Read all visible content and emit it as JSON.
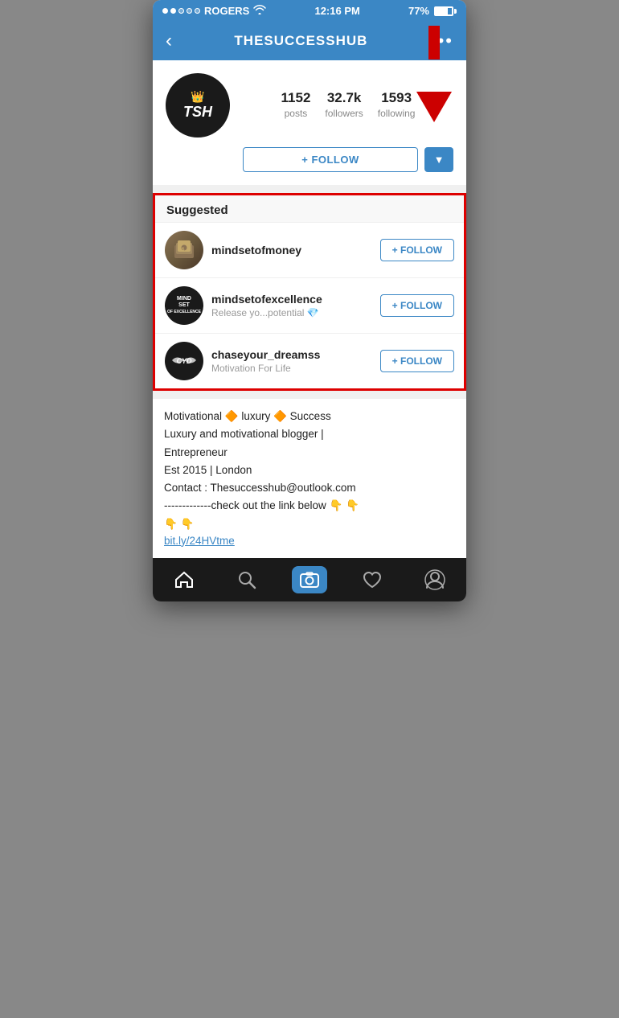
{
  "status_bar": {
    "carrier": "ROGERS",
    "time": "12:16 PM",
    "battery": "77%"
  },
  "nav": {
    "title": "THESUCCESSHUB",
    "back_label": "‹",
    "more_label": "•••"
  },
  "profile": {
    "username": "THESUCCESSHUB",
    "stats": [
      {
        "value": "1152",
        "label": "posts"
      },
      {
        "value": "32.7k",
        "label": "followers"
      },
      {
        "value": "1593",
        "label": "following"
      }
    ],
    "follow_label": "+ FOLLOW",
    "dropdown_label": "▼"
  },
  "suggested": {
    "title": "Suggested",
    "items": [
      {
        "username": "mindsetofmoney",
        "bio": "",
        "follow_label": "+ FOLLOW",
        "avatar_type": "money"
      },
      {
        "username": "mindsetofexcellence",
        "bio": "Release yo...potential 💎",
        "follow_label": "+ FOLLOW",
        "avatar_type": "excellence"
      },
      {
        "username": "chaseyour_dreamss",
        "bio": "Motivation For Life",
        "follow_label": "+ FOLLOW",
        "avatar_type": "cyd"
      }
    ]
  },
  "bio": {
    "line1": "Motivational 🔶 luxury 🔶 Success",
    "line2": "Luxury and motivational blogger |",
    "line3": "Entrepreneur",
    "line4": "Est 2015 | London",
    "line5": "Contact : Thesuccesshub@outlook.com",
    "line6": "-------------check out the link below 👇 👇",
    "line7": "👇 👇",
    "link": "bit.ly/24HVtme"
  },
  "bottom_nav": {
    "home_label": "🏠",
    "search_label": "🔍",
    "camera_label": "📷",
    "heart_label": "🤍",
    "profile_label": "👤"
  }
}
